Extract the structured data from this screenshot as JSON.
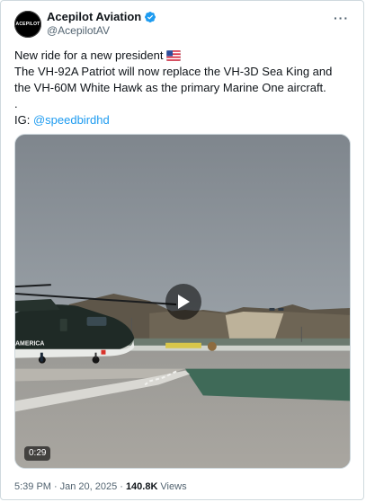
{
  "author": {
    "display_name": "Acepilot Aviation",
    "handle": "@AcepilotAV",
    "avatar_text": "ACEPILOT",
    "verified": true
  },
  "more_label": "···",
  "tweet": {
    "line1": "New ride for a new president",
    "line2": "The VH-92A Patriot will now replace the VH-3D Sea King and",
    "line3": "the VH-60M White Hawk as the primary Marine One aircraft.",
    "line4": ".",
    "ig_prefix": "IG: ",
    "ig_link": "@speedbirdhd"
  },
  "media": {
    "duration": "0:29",
    "helicopter_marking": "AMERICA"
  },
  "meta": {
    "time": "5:39 PM",
    "separator": "·",
    "date": "Jan 20, 2025",
    "views_count": "140.8K",
    "views_label": "Views"
  },
  "colors": {
    "link": "#1d9bf0",
    "secondary_text": "#536471",
    "verified_badge": "#1d9bf0"
  }
}
